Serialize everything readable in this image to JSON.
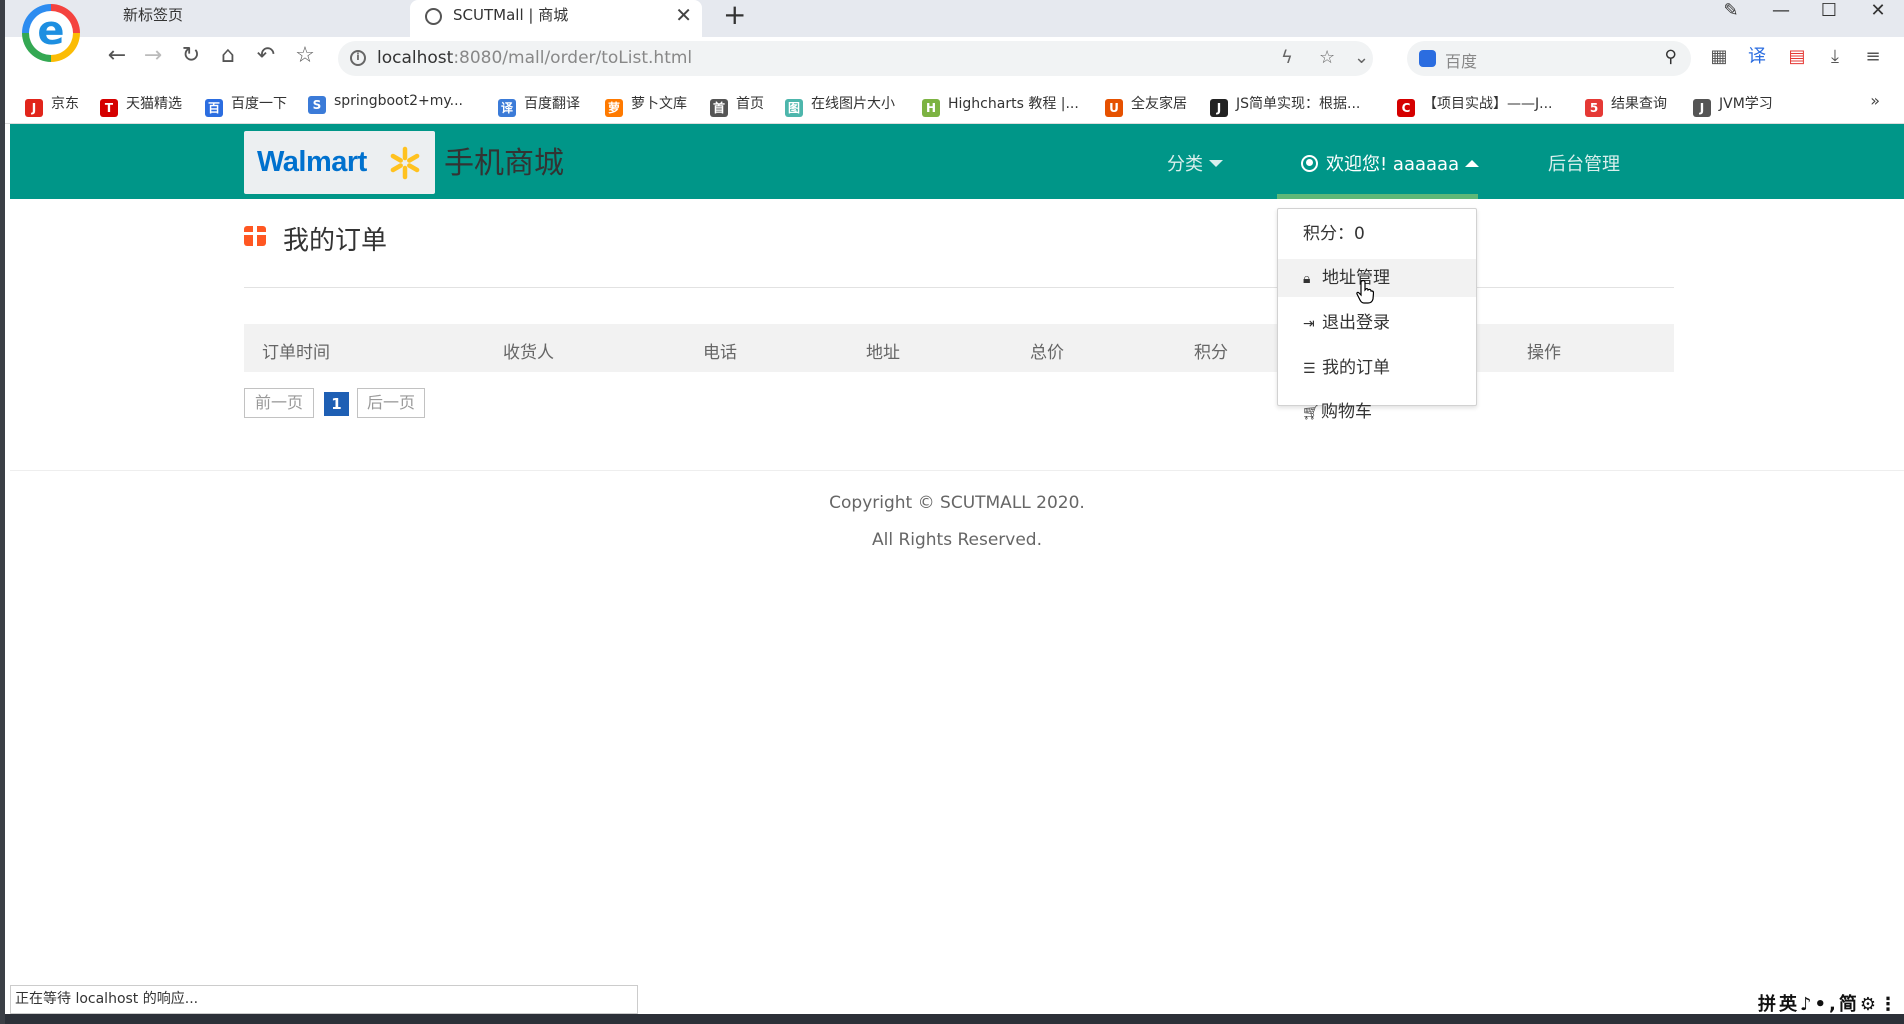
{
  "browser": {
    "tabs": [
      {
        "label": "新标签页"
      },
      {
        "label": "SCUTMall | 商城"
      }
    ],
    "url_host": "localhost",
    "url_rest": ":8080/mall/order/toList.html",
    "search_placeholder": "百度",
    "bookmarks": [
      {
        "label": "京东",
        "color": "#e1251b",
        "glyph": "JD"
      },
      {
        "label": "天猫精选",
        "color": "#d50000",
        "glyph": "T"
      },
      {
        "label": "百度一下",
        "color": "#2b6de0",
        "glyph": "百"
      },
      {
        "label": "springboot2+my...",
        "color": "#3b7bd8",
        "glyph": "S"
      },
      {
        "label": "百度翻译",
        "color": "#3b7bd8",
        "glyph": "译"
      },
      {
        "label": "萝卜文库",
        "color": "#ff7a00",
        "glyph": "萝"
      },
      {
        "label": "首页",
        "color": "#555555",
        "glyph": "首"
      },
      {
        "label": "在线图片大小",
        "color": "#4db6ac",
        "glyph": "图"
      },
      {
        "label": "Highcharts 教程 |...",
        "color": "#7cb342",
        "glyph": "H"
      },
      {
        "label": "全友家居",
        "color": "#e65100",
        "glyph": "U"
      },
      {
        "label": "JS简单实现：根据...",
        "color": "#222222",
        "glyph": "J"
      },
      {
        "label": "【项目实战】——J...",
        "color": "#d50000",
        "glyph": "C"
      },
      {
        "label": "结果查询",
        "color": "#e53935",
        "glyph": "5"
      },
      {
        "label": "JVM学习",
        "color": "#555555",
        "glyph": "J"
      }
    ],
    "status_text": "正在等待 localhost 的响应...",
    "ime_text": "拼英♪•,简⚙⋮"
  },
  "navbar": {
    "logo_text": "Walmart",
    "site_name": "手机商城",
    "category_label": "分类",
    "welcome_label": "欢迎您! aaaaaa",
    "admin_label": "后台管理",
    "bg_color": "#009688"
  },
  "dropdown": {
    "points_label": "积分：0",
    "items": [
      {
        "label": "地址管理",
        "icon": "lock-icon"
      },
      {
        "label": "退出登录",
        "icon": "sign-out-icon"
      },
      {
        "label": "我的订单",
        "icon": "list-icon"
      },
      {
        "label": "购物车",
        "icon": "cart-icon"
      }
    ]
  },
  "main": {
    "title": "我的订单",
    "columns": [
      "订单时间",
      "收货人",
      "电话",
      "地址",
      "总价",
      "积分",
      "操作"
    ],
    "pager": {
      "prev": "前一页",
      "current": "1",
      "next": "后一页"
    }
  },
  "footer": {
    "line1": "Copyright © SCUTMALL 2020.",
    "line2": "All Rights Reserved."
  }
}
